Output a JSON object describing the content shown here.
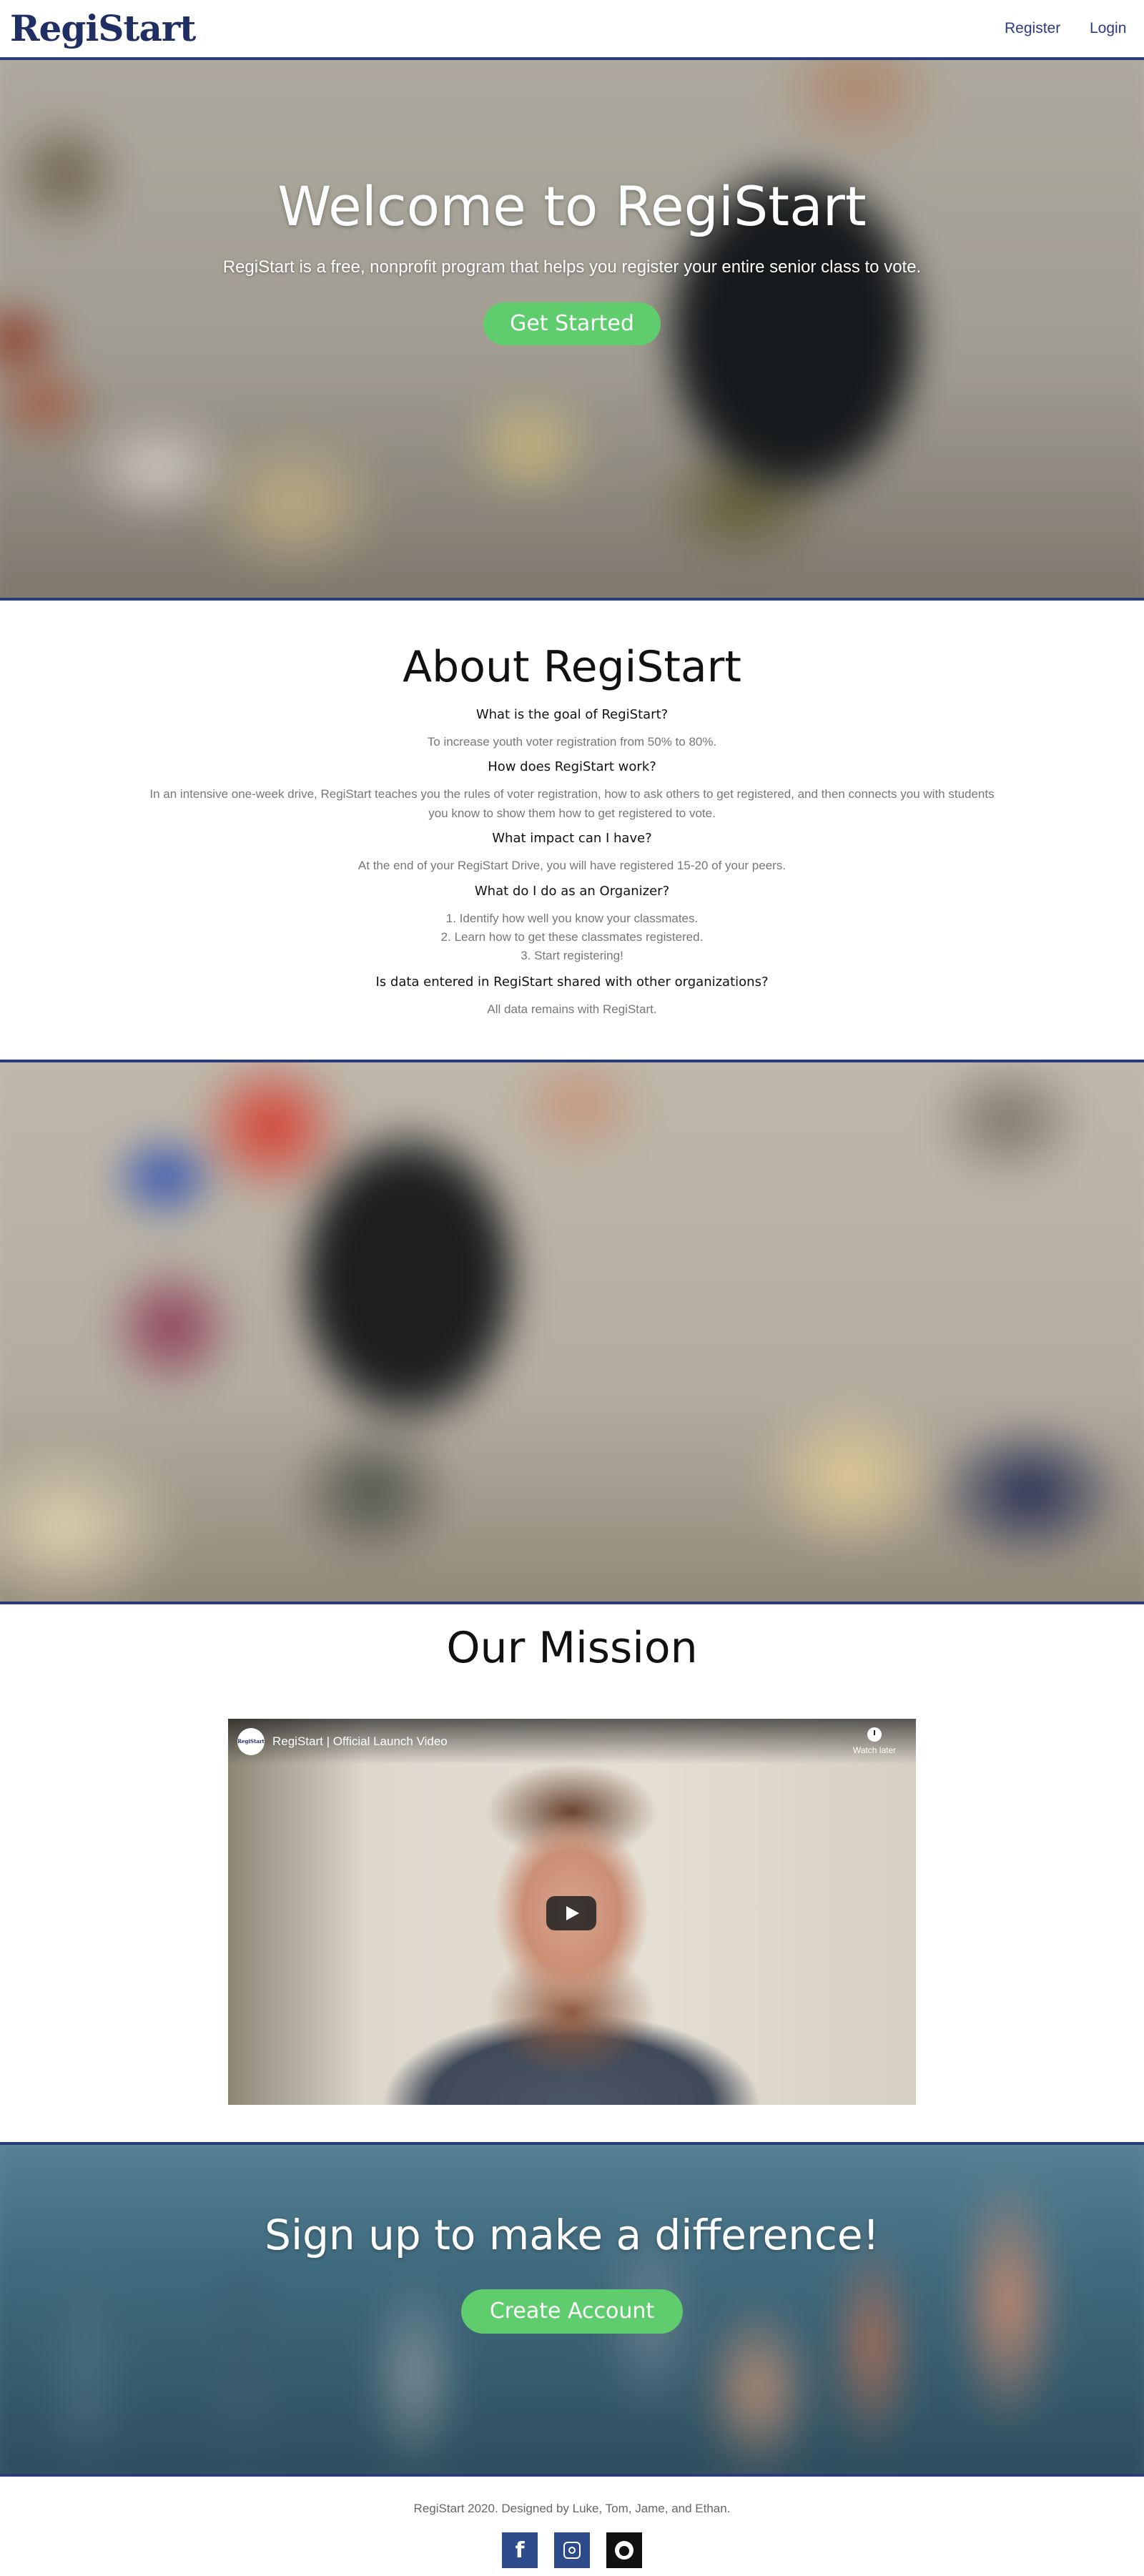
{
  "nav": {
    "logo": "RegiStart",
    "register_label": "Register",
    "login_label": "Login",
    "accent_color": "#2a3c7a"
  },
  "hero": {
    "title": "Welcome to RegiStart",
    "subtitle": "RegiStart is a free, nonprofit program that helps you register your entire senior class to vote.",
    "cta_label": "Get Started",
    "cta_color": "#5fcd6d"
  },
  "about": {
    "title": "About RegiStart",
    "faq": [
      {
        "q": "What is the goal of RegiStart?",
        "a": [
          "To increase youth voter registration from 50% to 80%."
        ]
      },
      {
        "q": "How does RegiStart work?",
        "a": [
          "In an intensive one-week drive, RegiStart teaches you the rules of voter registration, how to ask others to get registered, and then connects you with students you know to show them how to get registered to vote."
        ]
      },
      {
        "q": "What impact can I have?",
        "a": [
          "At the end of your RegiStart Drive, you will have registered 15-20 of your peers."
        ]
      },
      {
        "q": "What do I do as an Organizer?",
        "a": [
          "1. Identify how well you know your classmates.",
          "2. Learn how to get these classmates registered.",
          "3. Start registering!"
        ]
      },
      {
        "q": "Is data entered in RegiStart shared with other organizations?",
        "a": [
          "All data remains with RegiStart."
        ]
      }
    ]
  },
  "mission": {
    "title": "Our Mission",
    "video": {
      "channel_avatar_text": "RegiStart",
      "title": "RegiStart | Official Launch Video",
      "watch_later_label": "Watch later",
      "icons": [
        "clock-icon",
        "play-icon"
      ]
    }
  },
  "signup": {
    "title": "Sign up to make a difference!",
    "cta_label": "Create Account"
  },
  "footer": {
    "text": "RegiStart 2020. Designed by Luke, Tom, Jame, and Ethan.",
    "social_icons": [
      "facebook-icon",
      "instagram-icon",
      "github-icon"
    ],
    "facebook_glyph": "f"
  }
}
